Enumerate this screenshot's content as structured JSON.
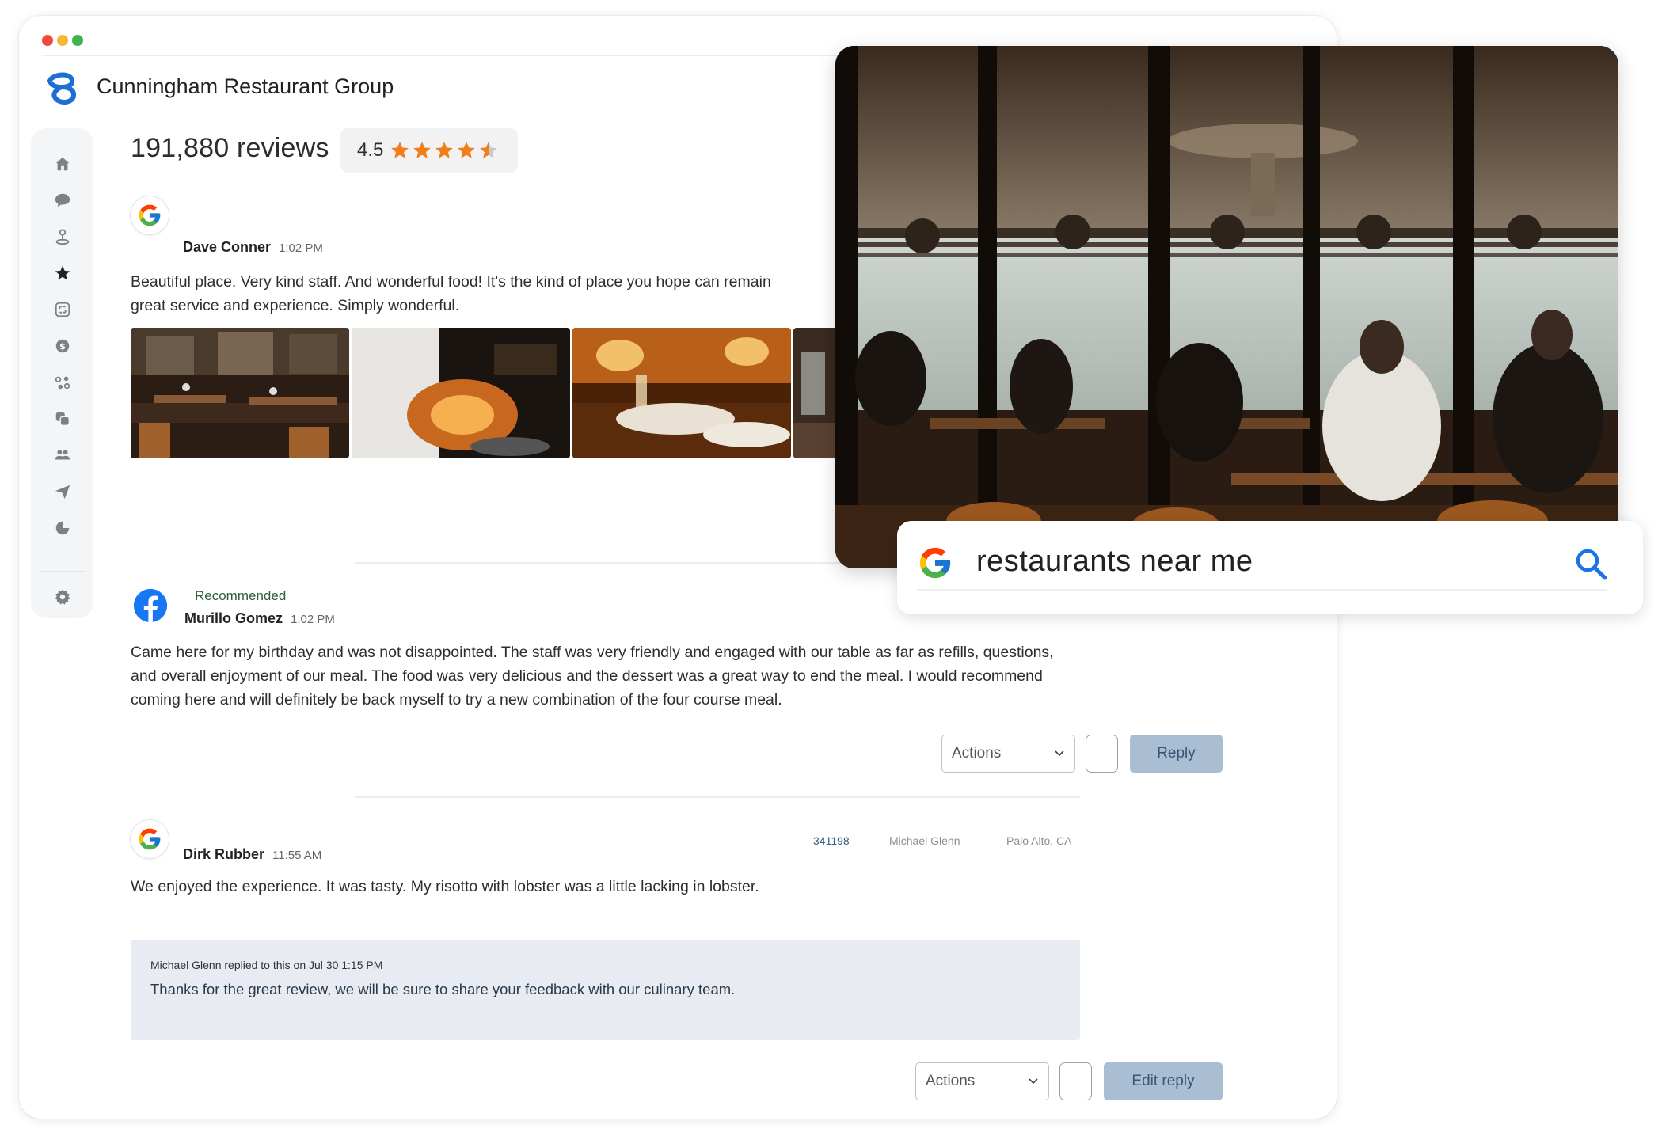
{
  "window": {
    "title": "Cunningham Restaurant Group",
    "traffic_lights": [
      "#ee4b3e",
      "#f7b731",
      "#3db34a"
    ]
  },
  "sidebar": {
    "items": [
      {
        "name": "home-icon"
      },
      {
        "name": "chat-bubble-icon"
      },
      {
        "name": "map-pin-icon"
      },
      {
        "name": "star-icon",
        "active": true
      },
      {
        "name": "widgets-icon"
      },
      {
        "name": "dollar-icon"
      },
      {
        "name": "integrations-icon"
      },
      {
        "name": "copy-icon"
      },
      {
        "name": "users-icon"
      },
      {
        "name": "send-icon"
      },
      {
        "name": "pie-chart-icon"
      }
    ],
    "settings": {
      "name": "gear-icon"
    }
  },
  "summary": {
    "reviews_count": "191,880 reviews",
    "rating": "4.5",
    "stars": 4.5,
    "star_color": "#f07f1a"
  },
  "reviews": [
    {
      "source": "google",
      "author": "Dave Conner",
      "time": "1:02 PM",
      "text": "Beautiful place. Very kind staff. And wonderful food! It's the kind of place you hope can remain",
      "text2": "great service and experience. Simply wonderful.",
      "photos": [
        "restaurant dining room",
        "chef cooking with flames",
        "plated dinner by candlelight",
        "wine glasses"
      ]
    },
    {
      "source": "facebook",
      "badge": "Recommended",
      "author": "Murillo Gomez",
      "time": "1:02 PM",
      "text": "Came here for my birthday and was not disappointed. The staff was very friendly and engaged with our table as far as refills, questions, and overall enjoyment of our meal. The food was very delicious and the dessert was a great way to end the meal. I would recommend coming here and will definitely be back myself to try a new combination of the four course meal.",
      "actions_label": "Actions",
      "reply_label": "Reply"
    },
    {
      "source": "google",
      "author": "Dirk Rubber",
      "time": "11:55 AM",
      "location_id": "341198",
      "assignee": "Michael Glenn",
      "location": "Palo Alto, CA",
      "text": "We enjoyed the experience. It was tasty. My risotto with lobster was a little lacking in lobster.",
      "reply": {
        "header": "Michael Glenn replied to this on Jul 30 1:15 PM",
        "body": "Thanks for the great review, we will be sure to share your feedback with our culinary team."
      },
      "actions_label": "Actions",
      "edit_reply_label": "Edit reply"
    }
  ],
  "first_review_actions_partial": "A",
  "search_overlay": {
    "query": "restaurants near me",
    "accent": "#1a73e8"
  }
}
